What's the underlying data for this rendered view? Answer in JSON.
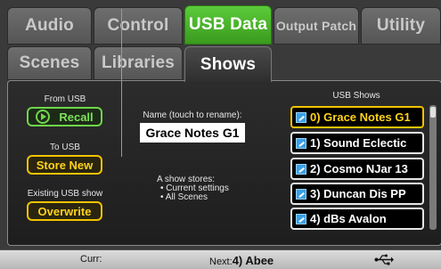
{
  "tabs_top": [
    {
      "label": "Audio"
    },
    {
      "label": "Control"
    },
    {
      "label": "USB Data"
    },
    {
      "label": "Output Patch"
    },
    {
      "label": "Utility"
    }
  ],
  "tabs_second": [
    {
      "label": "Scenes"
    },
    {
      "label": "Libraries"
    },
    {
      "label": "Shows"
    }
  ],
  "left": {
    "from_usb_label": "From USB",
    "recall_label": "Recall",
    "to_usb_label": "To USB",
    "store_new_label": "Store New",
    "existing_label": "Existing USB show",
    "overwrite_label": "Overwrite"
  },
  "center": {
    "name_label": "Name (touch to rename):",
    "name_value": "Grace Notes G1",
    "info_title": "A show stores:",
    "info_items": [
      "Current settings",
      "All Scenes"
    ]
  },
  "usb_shows": {
    "title": "USB Shows",
    "items": [
      {
        "label": "0) Grace Notes G1"
      },
      {
        "label": "1) Sound Eclectic"
      },
      {
        "label": "2) Cosmo NJar 13"
      },
      {
        "label": "3) Duncan Dis PP"
      },
      {
        "label": "4) dBs Avalon"
      }
    ]
  },
  "status": {
    "curr_label": "Curr:",
    "next_label": "Next:",
    "next_value": "4) Abee",
    "usb_icon": "usb-icon"
  },
  "colors": {
    "accent_green": "#4bb52a",
    "highlight_yellow": "#f2c300"
  }
}
